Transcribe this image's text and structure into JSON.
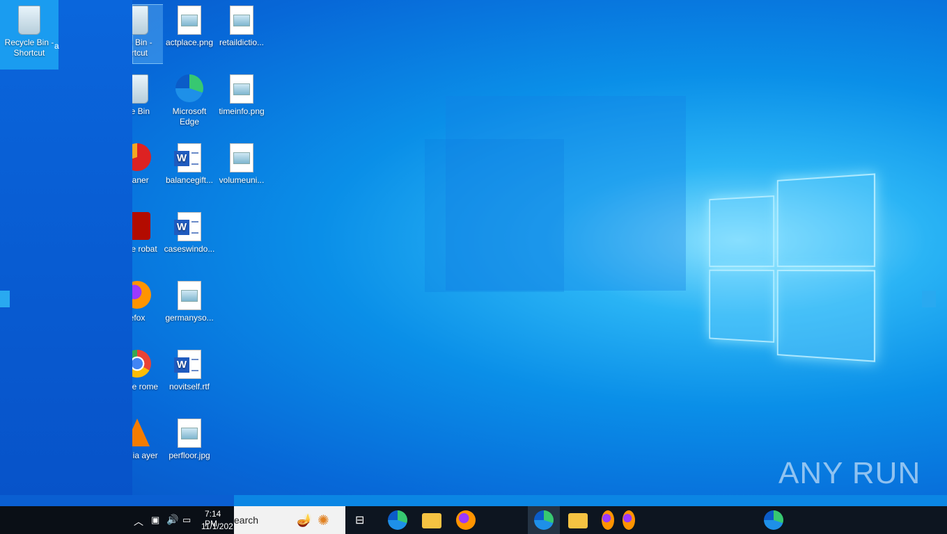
{
  "desktop": {
    "selected_icon": {
      "label": "Recycle Bin - Shortcut",
      "extra": "a"
    },
    "column_partial": [
      {
        "label": "cle Bin - ortcut",
        "icon": "recycle-bin-icon"
      },
      {
        "label": "cle Bin",
        "icon": "recycle-bin-icon"
      },
      {
        "label": "leaner",
        "icon": "ccleaner-icon"
      },
      {
        "label": "dobe robat",
        "icon": "adobe-acrobat-icon"
      },
      {
        "label": "efox",
        "icon": "firefox-icon"
      },
      {
        "label": "oogle rome",
        "icon": "chrome-icon"
      },
      {
        "label": "media ayer",
        "icon": "vlc-icon"
      }
    ],
    "column2": [
      {
        "label": "actplace.png",
        "icon": "image-file-icon"
      },
      {
        "label": "Microsoft Edge",
        "icon": "edge-icon"
      },
      {
        "label": "balancegift...",
        "icon": "word-file-icon"
      },
      {
        "label": "caseswindo...",
        "icon": "word-file-icon"
      },
      {
        "label": "germanyso...",
        "icon": "image-file-icon"
      },
      {
        "label": "novitself.rtf",
        "icon": "word-file-icon"
      },
      {
        "label": "perfloor.jpg",
        "icon": "image-file-icon"
      }
    ],
    "column3": [
      {
        "label": "retaildictio...",
        "icon": "image-file-icon"
      },
      {
        "label": "timeinfo.png",
        "icon": "image-file-icon"
      },
      {
        "label": "volumeuni...",
        "icon": "image-file-icon"
      }
    ]
  },
  "taskbar": {
    "time": "7:14 PM",
    "date": "11/1/202",
    "search_text": "earch"
  },
  "watermark": "ANY RUN",
  "colors": {
    "taskbar": "#0d1520",
    "accent": "#0b86e4"
  }
}
